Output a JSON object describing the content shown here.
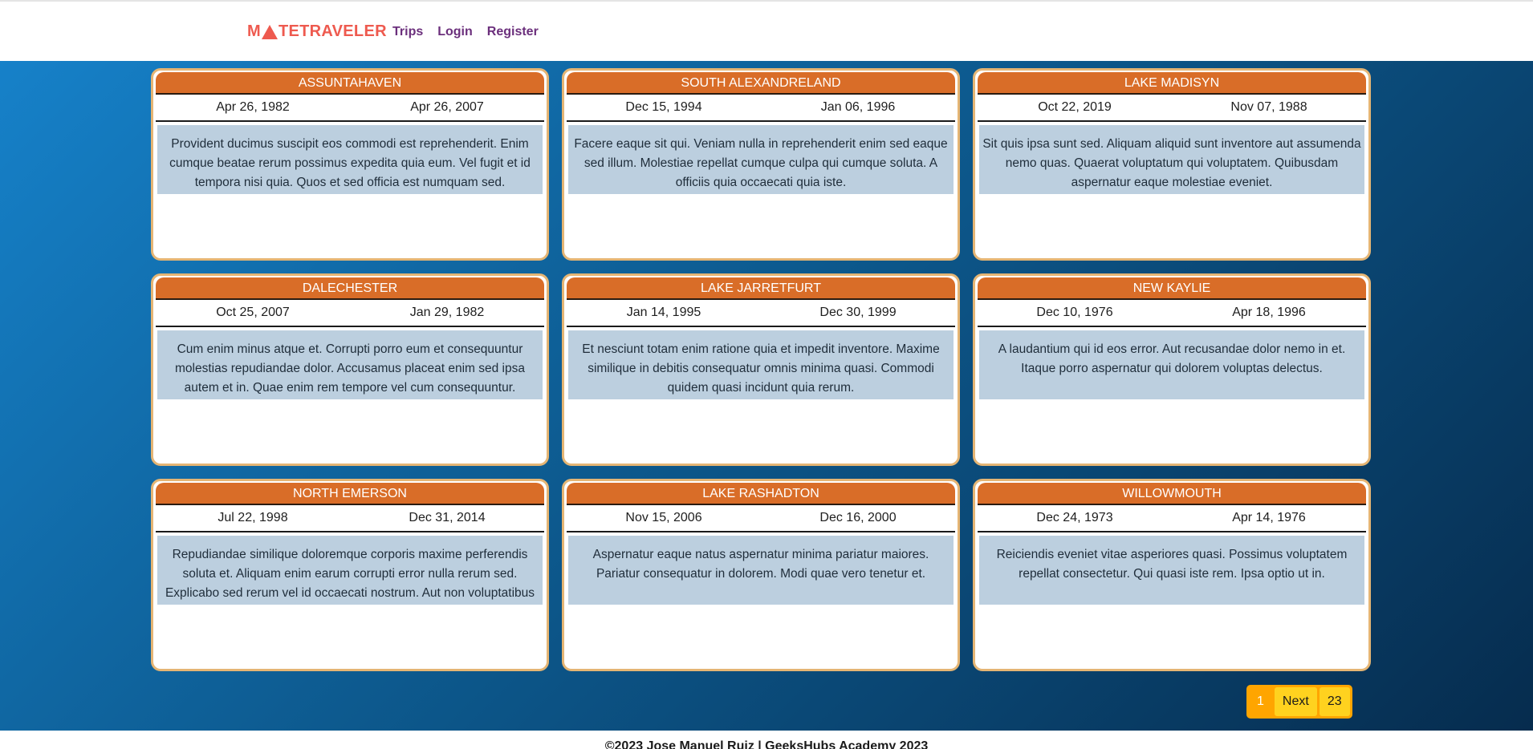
{
  "brand": {
    "prefix": "M",
    "suffix": "TETRAVELER",
    "logo_color": "#ee5a4f"
  },
  "nav": {
    "trips": "Trips",
    "login": "Login",
    "register": "Register"
  },
  "trips": [
    {
      "title": "ASSUNTAHAVEN",
      "start": "Apr 26, 1982",
      "end": "Apr 26, 2007",
      "description": "Provident ducimus suscipit eos commodi est reprehenderit. Enim cumque beatae rerum possimus expedita quia eum. Vel fugit et id tempora nisi quia. Quos et sed officia est numquam sed."
    },
    {
      "title": "SOUTH ALEXANDRELAND",
      "start": "Dec 15, 1994",
      "end": "Jan 06, 1996",
      "description": "Facere eaque sit qui. Veniam nulla in reprehenderit enim sed eaque sed illum. Molestiae repellat cumque culpa qui cumque soluta. A officiis quia occaecati quia iste."
    },
    {
      "title": "LAKE MADISYN",
      "start": "Oct 22, 2019",
      "end": "Nov 07, 1988",
      "description": "Sit quis ipsa sunt sed. Aliquam aliquid sunt inventore aut assumenda nemo quas. Quaerat voluptatum qui voluptatem. Quibusdam aspernatur eaque molestiae eveniet."
    },
    {
      "title": "DALECHESTER",
      "start": "Oct 25, 2007",
      "end": "Jan 29, 1982",
      "description": "Cum enim minus atque et. Corrupti porro eum et consequuntur molestias repudiandae dolor. Accusamus placeat enim sed ipsa autem et in. Quae enim rem tempore vel cum consequuntur."
    },
    {
      "title": "LAKE JARRETFURT",
      "start": "Jan 14, 1995",
      "end": "Dec 30, 1999",
      "description": "Et nesciunt totam enim ratione quia et impedit inventore. Maxime similique in debitis consequatur omnis minima quasi. Commodi quidem quasi incidunt quia rerum."
    },
    {
      "title": "NEW KAYLIE",
      "start": "Dec 10, 1976",
      "end": "Apr 18, 1996",
      "description": "A laudantium qui id eos error. Aut recusandae dolor nemo in et. Itaque porro aspernatur qui dolorem voluptas delectus."
    },
    {
      "title": "NORTH EMERSON",
      "start": "Jul 22, 1998",
      "end": "Dec 31, 2014",
      "description": "Repudiandae similique doloremque corporis maxime perferendis soluta et. Aliquam enim earum corrupti error nulla rerum sed. Explicabo sed rerum vel id occaecati nostrum. Aut non voluptatibus"
    },
    {
      "title": "LAKE RASHADTON",
      "start": "Nov 15, 2006",
      "end": "Dec 16, 2000",
      "description": "Aspernatur eaque natus aspernatur minima pariatur maiores. Pariatur consequatur in dolorem. Modi quae vero tenetur et."
    },
    {
      "title": "WILLOWMOUTH",
      "start": "Dec 24, 1973",
      "end": "Apr 14, 1976",
      "description": "Reiciendis eveniet vitae asperiores quasi. Possimus voluptatem repellat consectetur. Qui quasi iste rem. Ipsa optio ut in."
    }
  ],
  "pagination": {
    "current": "1",
    "next": "Next",
    "last": "23"
  },
  "footer": {
    "text": "©2023 Jose Manuel Ruiz | GeeksHubs Academy 2023"
  },
  "colors": {
    "card_header": "#d96d28",
    "card_border": "#e5b574",
    "description_bg": "#bccfdf",
    "nav_link": "#6b2f7c",
    "pagination_bg": "#ffa500",
    "pagination_button": "#ffd21f"
  }
}
